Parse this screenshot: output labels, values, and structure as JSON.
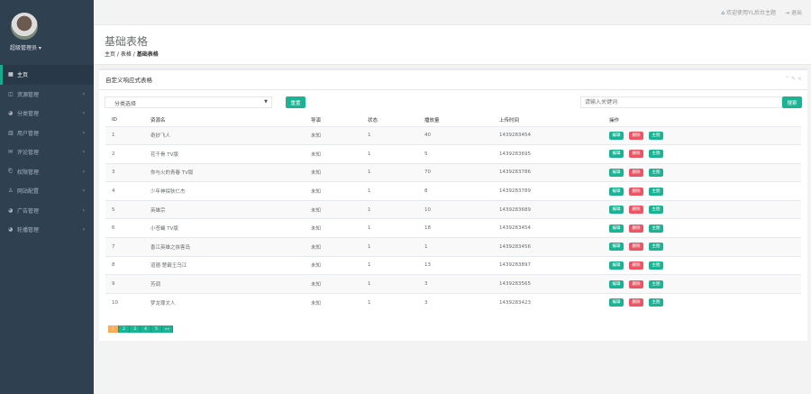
{
  "sidebar": {
    "username": "超级管理员 ▾",
    "items": [
      {
        "label": "主页",
        "icon": "▦"
      },
      {
        "label": "资源管理",
        "icon": "◫"
      },
      {
        "label": "分类管理",
        "icon": "◕"
      },
      {
        "label": "用户管理",
        "icon": "▥"
      },
      {
        "label": "评论管理",
        "icon": "✉"
      },
      {
        "label": "权限管理",
        "icon": "⎗"
      },
      {
        "label": "网站配置",
        "icon": "♙"
      },
      {
        "label": "广告管理",
        "icon": "◕"
      },
      {
        "label": "轮播管理",
        "icon": "◕"
      }
    ]
  },
  "topbar": {
    "welcome": "欢迎使用YL后台主题",
    "logout": "退出"
  },
  "header": {
    "title": "基础表格",
    "crumb1": "主页",
    "crumb2": "表格",
    "crumb3": "基础表格"
  },
  "panel": {
    "title": "自定义响应式表格",
    "select": "分类选择",
    "reset": "重置",
    "search_placeholder": "请输入关键词",
    "search": "搜索"
  },
  "table": {
    "headers": [
      "ID",
      "资源名",
      "导演",
      "状态",
      "播放量",
      "上传时间",
      "操作"
    ],
    "actions": [
      "编辑",
      "删除",
      "主图"
    ],
    "rows": [
      [
        "1",
        "奇妙飞人",
        "未知",
        "1",
        "40",
        "1439283454"
      ],
      [
        "2",
        "花千骨 TV版",
        "未知",
        "1",
        "5",
        "1439283695"
      ],
      [
        "3",
        "你与火的青春 TV版",
        "未知",
        "1",
        "70",
        "1439283786"
      ],
      [
        "4",
        "少年神探狄仁杰",
        "未知",
        "1",
        "8",
        "1439283789"
      ],
      [
        "5",
        "英雄宗",
        "未知",
        "1",
        "10",
        "1439283689"
      ],
      [
        "6",
        "小苍蝇 TV版",
        "未知",
        "1",
        "18",
        "1439283454"
      ],
      [
        "7",
        "香江英雄之侠客岛",
        "未知",
        "1",
        "1",
        "1439283456"
      ],
      [
        "8",
        "道德·楚霸王乌江",
        "未知",
        "1",
        "13",
        "1439283897"
      ],
      [
        "9",
        "芳调",
        "未知",
        "1",
        "3",
        "1439283565"
      ],
      [
        "10",
        "梦龙罪文人",
        "未知",
        "1",
        "3",
        "1439283423"
      ]
    ]
  },
  "pagination": [
    "1",
    "2",
    "3",
    "4",
    "5",
    "»»"
  ]
}
